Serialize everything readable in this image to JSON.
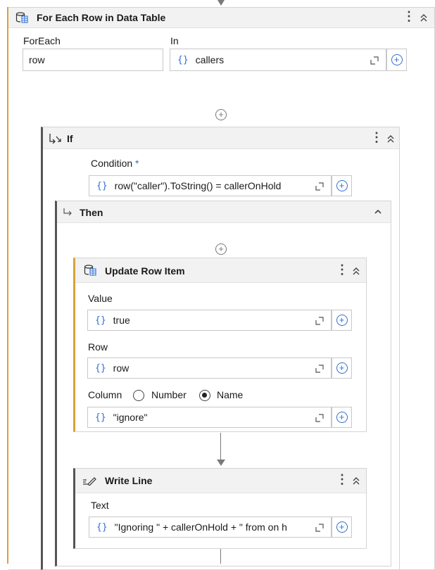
{
  "foreach_activity": {
    "title": "For Each Row in Data Table",
    "foreach_label": "ForEach",
    "foreach_value": "row",
    "in_label": "In",
    "in_value": "callers"
  },
  "if_activity": {
    "title": "If",
    "condition_label": "Condition",
    "required_mark": "*",
    "condition_value": "row(\"caller\").ToString() = callerOnHold",
    "then_label": "Then"
  },
  "update_row_item": {
    "title": "Update Row Item",
    "value_label": "Value",
    "value_value": "true",
    "row_label": "Row",
    "row_value": "row",
    "column_label": "Column",
    "option_number": "Number",
    "option_name": "Name",
    "selected_option": "Name",
    "column_value": "\"ignore\""
  },
  "write_line": {
    "title": "Write Line",
    "text_label": "Text",
    "text_value": "\"Ignoring \" + callerOnHold + \" from on h"
  },
  "icons": {
    "expression": "{}",
    "kebab": "⋮",
    "collapse": "^",
    "plus": "+"
  },
  "colors": {
    "accent_orange": "#d9a13a",
    "expression_blue": "#2f6fd1",
    "header_gray": "#f2f2f2"
  }
}
